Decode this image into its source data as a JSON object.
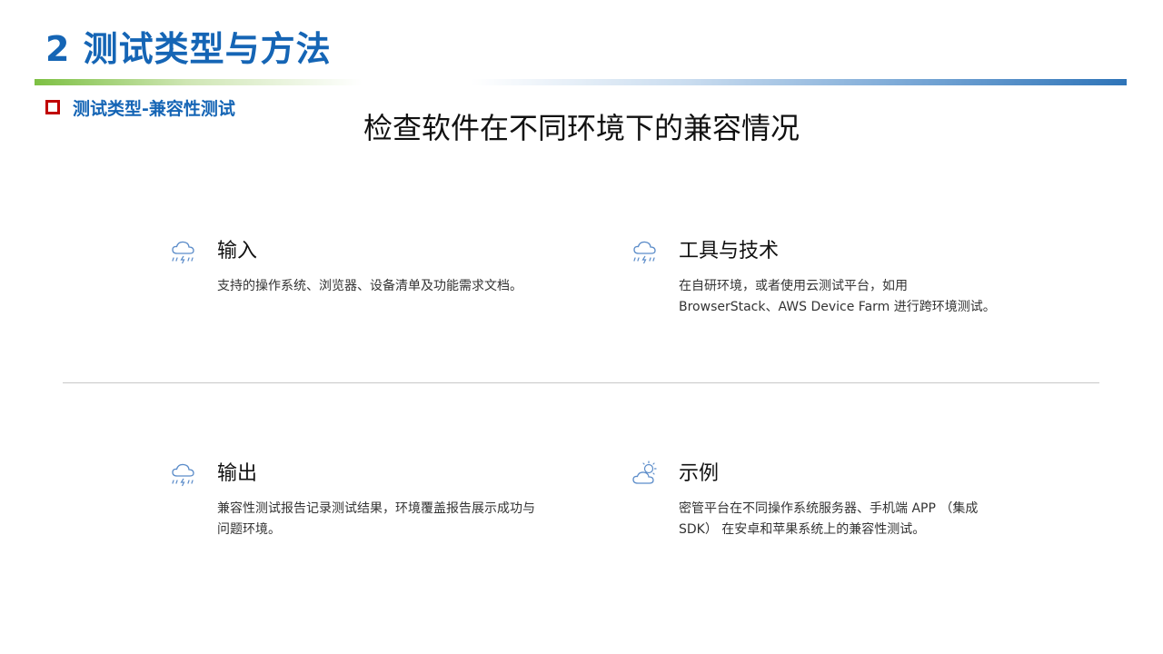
{
  "header": {
    "title": "2 测试类型与方法",
    "section_label": "测试类型-兼容性测试"
  },
  "headline": "检查软件在不同环境下的兼容情况",
  "cards": [
    {
      "icon": "rain-cloud-icon",
      "title": "输入",
      "body": "支持的操作系统、浏览器、设备清单及功能需求文档。"
    },
    {
      "icon": "rain-cloud-icon",
      "title": "工具与技术",
      "body": "在自研环境，或者使用云测试平台，如用 BrowserStack、AWS Device Farm 进行跨环境测试。"
    },
    {
      "icon": "rain-cloud-icon",
      "title": "输出",
      "body": "兼容性测试报告记录测试结果，环境覆盖报告展示成功与问题环境。"
    },
    {
      "icon": "partly-sunny-icon",
      "title": "示例",
      "body": "密管平台在不同操作系统服务器、手机端 APP （集成SDK） 在安卓和苹果系统上的兼容性测试。"
    }
  ],
  "colors": {
    "title_blue": "#1565b5",
    "marker_red": "#c00000",
    "icon_blue": "#5b8cc9"
  }
}
